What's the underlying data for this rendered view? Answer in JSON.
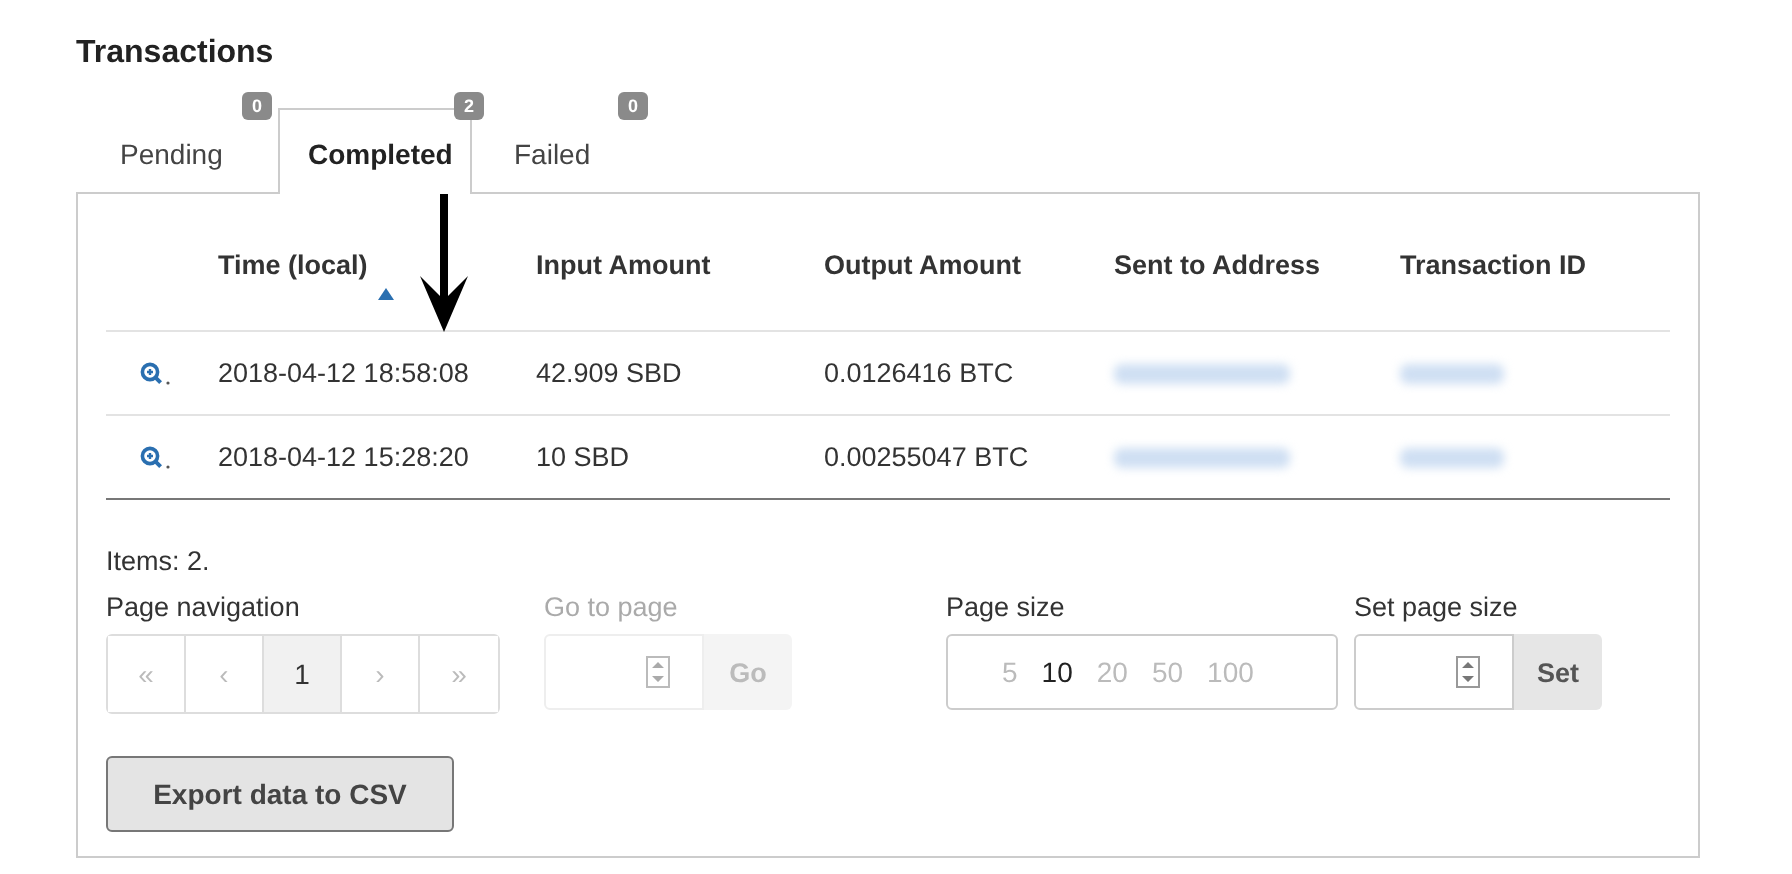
{
  "title": "Transactions",
  "tabs": [
    {
      "label": "Pending",
      "badge": "0",
      "selected": false
    },
    {
      "label": "Completed",
      "badge": "2",
      "selected": true
    },
    {
      "label": "Failed",
      "badge": "0",
      "selected": false
    }
  ],
  "table": {
    "columns": [
      {
        "label": "Time (local)",
        "sorted": true
      },
      {
        "label": "Input Amount",
        "sorted": false
      },
      {
        "label": "Output Amount",
        "sorted": false
      },
      {
        "label": "Sent to Address",
        "sorted": false
      },
      {
        "label": "Transaction ID",
        "sorted": false
      }
    ],
    "rows": [
      {
        "time": "2018-04-12 18:58:08",
        "input": "42.909 SBD",
        "output": "0.0126416 BTC"
      },
      {
        "time": "2018-04-12 15:28:20",
        "input": "10 SBD",
        "output": "0.00255047 BTC"
      }
    ]
  },
  "items_text": "Items: 2.",
  "pagination": {
    "label": "Page navigation",
    "buttons": [
      {
        "label": "«",
        "disabled": true,
        "selected": false
      },
      {
        "label": "‹",
        "disabled": true,
        "selected": false
      },
      {
        "label": "1",
        "disabled": false,
        "selected": true
      },
      {
        "label": "›",
        "disabled": true,
        "selected": false
      },
      {
        "label": "»",
        "disabled": true,
        "selected": false
      }
    ]
  },
  "go_to_page": {
    "label": "Go to page",
    "button": "Go",
    "disabled": true
  },
  "page_size": {
    "label": "Page size",
    "options": [
      {
        "label": "5",
        "selected": false
      },
      {
        "label": "10",
        "selected": true
      },
      {
        "label": "20",
        "selected": false
      },
      {
        "label": "50",
        "selected": false
      },
      {
        "label": "100",
        "selected": false
      }
    ]
  },
  "set_page_size": {
    "label": "Set page size",
    "button": "Set",
    "disabled": false
  },
  "export_button": "Export data to CSV"
}
